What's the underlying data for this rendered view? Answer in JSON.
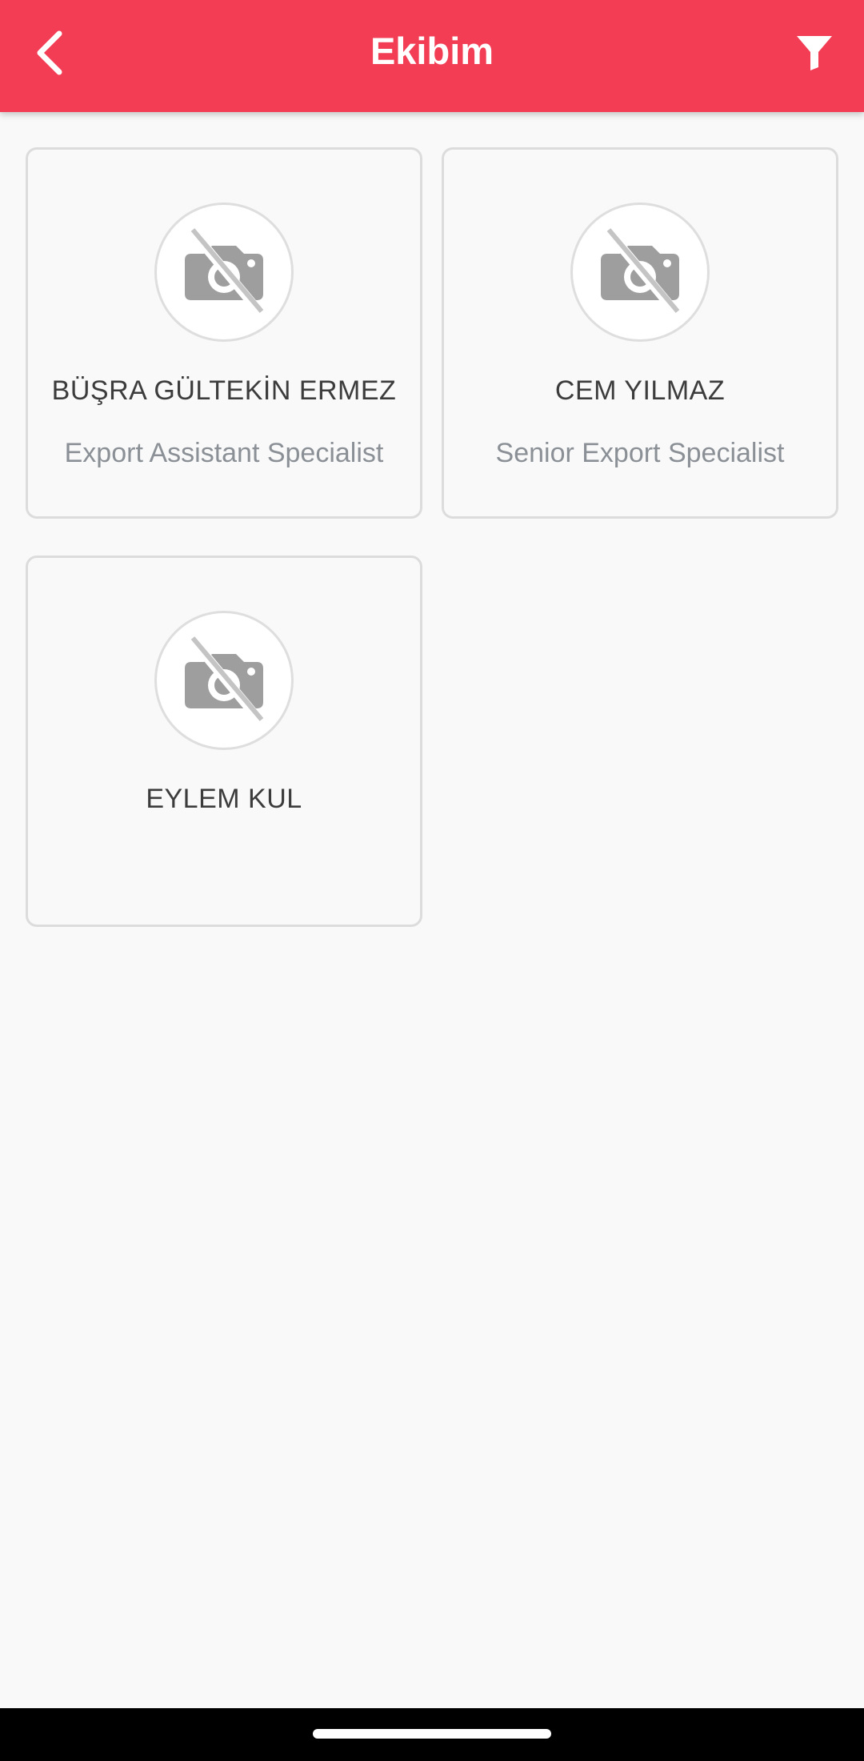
{
  "header": {
    "title": "Ekibim",
    "back_icon": "chevron-left-icon",
    "filter_icon": "filter-icon"
  },
  "colors": {
    "app_bar": "#f23d55",
    "background": "#f9f9f9",
    "name_text": "#3c3c3c",
    "role_text": "#8a9096"
  },
  "members": [
    {
      "name": "BÜŞRA GÜLTEKİN ERMEZ",
      "role": "Export Assistant Specialist",
      "avatar_icon": "no-photo-icon"
    },
    {
      "name": "CEM YILMAZ",
      "role": "Senior Export Specialist",
      "avatar_icon": "no-photo-icon"
    },
    {
      "name": "EYLEM KUL",
      "role": "",
      "avatar_icon": "no-photo-icon"
    }
  ]
}
